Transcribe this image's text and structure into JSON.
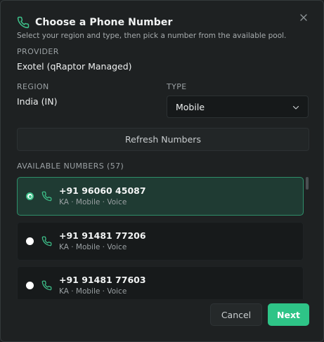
{
  "dialog": {
    "title": "Choose a Phone Number",
    "subtitle": "Select your region and type, then pick a number from the available pool."
  },
  "provider": {
    "label": "PROVIDER",
    "value": "Exotel (qRaptor Managed)"
  },
  "region": {
    "label": "REGION",
    "value": "India (IN)"
  },
  "type": {
    "label": "TYPE",
    "selected": "Mobile"
  },
  "refresh_label": "Refresh Numbers",
  "available": {
    "label": "AVAILABLE NUMBERS (57)"
  },
  "numbers": [
    {
      "number": "+91 96060 45087",
      "meta": "KA · Mobile · Voice",
      "selected": true
    },
    {
      "number": "+91 91481 77206",
      "meta": "KA · Mobile · Voice",
      "selected": false
    },
    {
      "number": "+91 91481 77603",
      "meta": "KA · Mobile · Voice",
      "selected": false
    }
  ],
  "footer": {
    "cancel_label": "Cancel",
    "next_label": "Next"
  },
  "colors": {
    "accent": "#2ec487",
    "selected_bg": "#1f3b33",
    "dialog_bg": "#1e2122"
  },
  "icons": {
    "title": "phone-icon",
    "close": "close-icon",
    "dropdown": "chevron-down-icon"
  }
}
